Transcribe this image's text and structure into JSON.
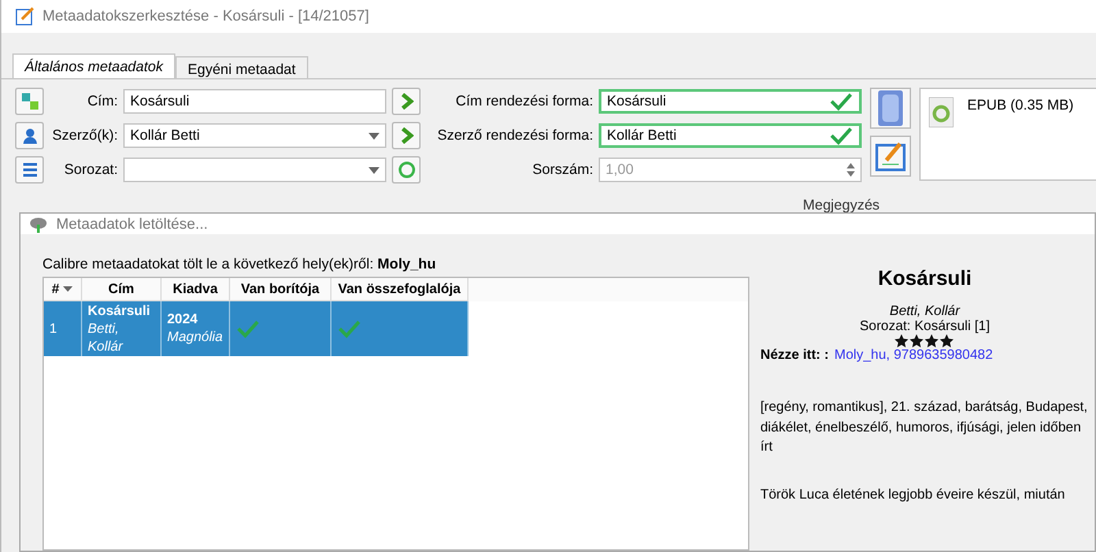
{
  "window": {
    "title": "Metaadatokszerkesztése - Kosársuli - [14/21057]"
  },
  "tabs": [
    {
      "label": "Általános metaadatok",
      "selected": true
    },
    {
      "label": "Egyéni metaadat",
      "selected": false
    }
  ],
  "form": {
    "title_label": "Cím:",
    "title_value": "Kosársuli",
    "authors_label": "Szerző(k):",
    "authors_value": "Kollár Betti",
    "series_label": "Sorozat:",
    "title_sort_label": "Cím rendezési forma:",
    "title_sort_value": "Kosársuli",
    "author_sort_label": "Szerző rendezési forma:",
    "author_sort_value": "Kollár Betti",
    "number_label": "Sorszám:",
    "number_placeholder": "1,00"
  },
  "formats": [
    "EPUB (0.35 MB)"
  ],
  "comments_label": "Megjegyzés",
  "dialog": {
    "title": "Metaadatok letöltése...",
    "intro": "Calibre metaadatokat tölt le a következő hely(ek)ről: **Moly_hu**",
    "columns": [
      "#",
      "Cím",
      "Kiadva",
      "Van borítója",
      "Van összefoglalója"
    ],
    "rows": [
      {
        "number": "1",
        "title": "Kosársuli",
        "author": "Betti, Kollár",
        "year": "2024",
        "publisher": "Magnólia",
        "has_cover": true,
        "has_summary": true,
        "selected": true
      }
    ],
    "details": {
      "title": "Kosársuli",
      "author": "Betti, Kollár",
      "series": "Sorozat: Kosársuli [1]",
      "stars": 4,
      "source_label": "Nézze itt: :",
      "source_link": "Moly_hu, 9789635980482",
      "tags": "[regény, romantikus], 21. század, barátság, Budapest, diákélet, énelbeszélő, humoros, ifjúsági, jelen időben írt",
      "summary": "Török Luca életének legjobb éveire készül, miután"
    }
  }
}
